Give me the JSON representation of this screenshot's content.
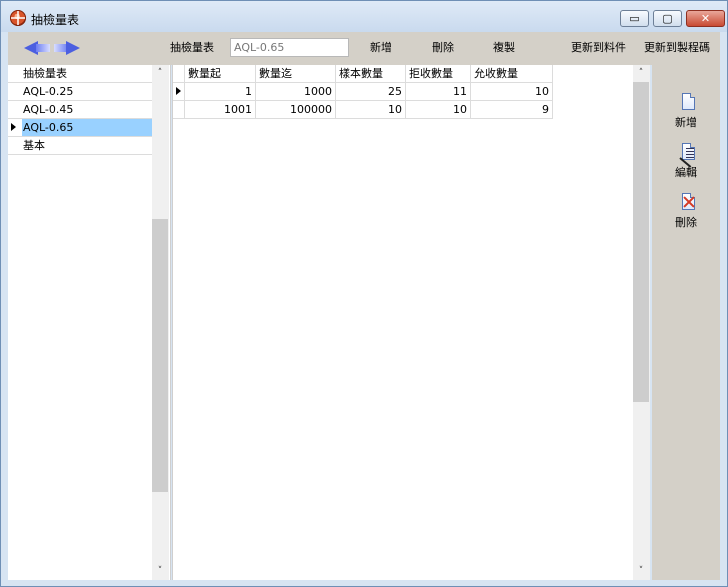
{
  "window": {
    "title": "抽檢量表",
    "minimize_icon": "minimize-icon",
    "maximize_icon": "maximize-icon",
    "close_icon": "close-icon",
    "min_glyph": "▭",
    "max_glyph": "▢",
    "close_glyph": "✕"
  },
  "toolbar": {
    "label": "抽檢量表",
    "input_value": "AQL-0.65",
    "new_label": "新增",
    "delete_label": "刪除",
    "copy_label": "複製",
    "update_material_label": "更新到料件",
    "update_process_label": "更新到製程碼"
  },
  "left_list": {
    "header": "抽檢量表",
    "items": [
      {
        "label": "AQL-0.25",
        "selected": false
      },
      {
        "label": "AQL-0.45",
        "selected": false
      },
      {
        "label": "AQL-0.65",
        "selected": true
      },
      {
        "label": "基本",
        "selected": false
      }
    ]
  },
  "grid": {
    "columns": [
      "數量起",
      "數量迄",
      "樣本數量",
      "拒收數量",
      "允收數量"
    ],
    "rows": [
      {
        "current": true,
        "cells": [
          "1",
          "1000",
          "25",
          "11",
          "10"
        ]
      },
      {
        "current": false,
        "cells": [
          "1001",
          "100000",
          "10",
          "10",
          "9"
        ]
      }
    ]
  },
  "actions": {
    "new_label": "新增",
    "edit_label": "編輯",
    "delete_label": "刪除",
    "new_icon": "new-document-icon",
    "edit_icon": "edit-document-icon",
    "delete_icon": "delete-x-icon"
  },
  "scroll": {
    "up_glyph": "˄",
    "down_glyph": "˅"
  },
  "colors": {
    "selection": "#99d1ff",
    "window_frame": "#d7e4f2",
    "toolbar_bg": "#d4d0c8"
  }
}
